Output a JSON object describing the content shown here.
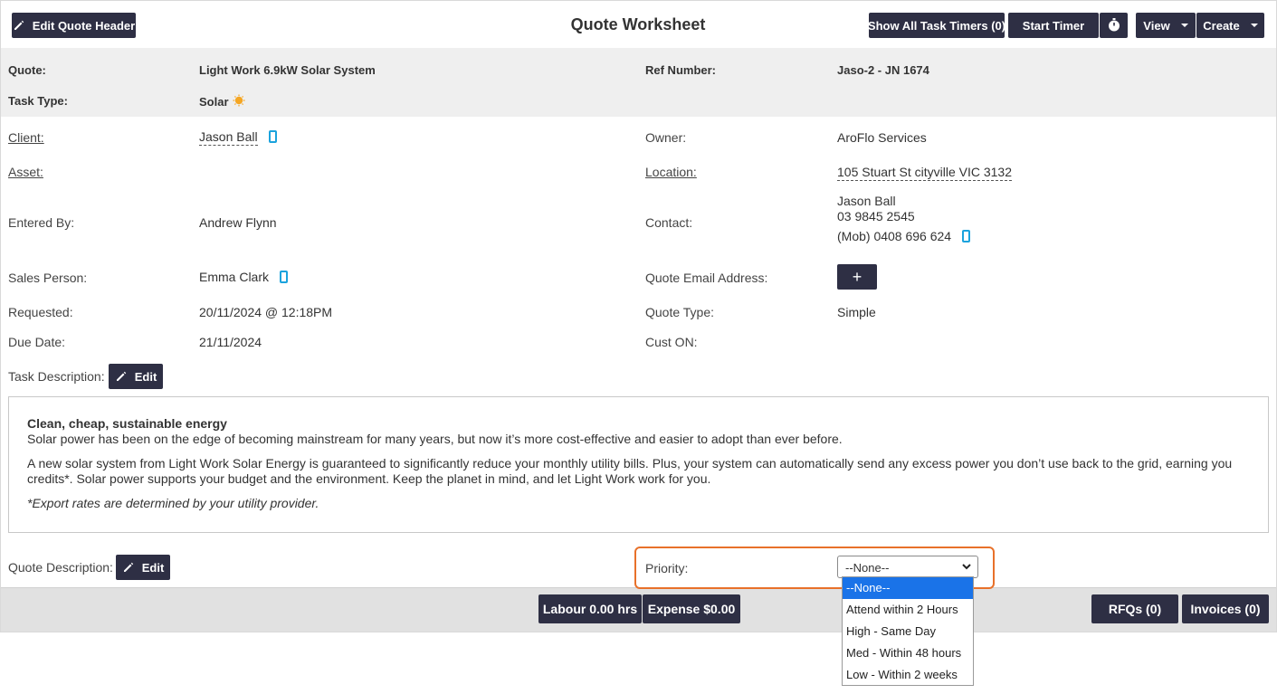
{
  "header": {
    "edit_quote_header": "Edit Quote Header",
    "title": "Quote Worksheet",
    "show_timers": "Show All Task Timers (0)",
    "start_timer": "Start Timer",
    "view": "View",
    "create": "Create"
  },
  "summary": {
    "quote_label": "Quote:",
    "quote_value": "Light Work 6.9kW Solar System",
    "ref_label": "Ref Number:",
    "ref_value": "Jaso-2 - JN 1674",
    "task_type_label": "Task Type:",
    "task_type_value": "Solar"
  },
  "details": {
    "client_label": "Client:",
    "client_value": "Jason Ball",
    "owner_label": "Owner:",
    "owner_value": "AroFlo Services",
    "asset_label": "Asset:",
    "location_label": "Location:",
    "location_value": "105 Stuart St cityville VIC 3132",
    "entered_by_label": "Entered By:",
    "entered_by_value": "Andrew Flynn",
    "contact_label": "Contact:",
    "contact_name": "Jason Ball",
    "contact_phone": "03 9845 2545",
    "contact_mobile": "(Mob) 0408 696 624",
    "sales_person_label": "Sales Person:",
    "sales_person_value": "Emma Clark",
    "quote_email_label": "Quote Email Address:",
    "add_email": "+",
    "requested_label": "Requested:",
    "requested_value": "20/11/2024 @ 12:18PM",
    "quote_type_label": "Quote Type:",
    "quote_type_value": "Simple",
    "due_date_label": "Due Date:",
    "due_date_value": "21/11/2024",
    "cust_on_label": "Cust ON:"
  },
  "task_description": {
    "label": "Task Description:",
    "edit": "Edit",
    "heading": "Clean, cheap, sustainable energy",
    "line1": "Solar power has been on the edge of becoming mainstream for many years, but now it’s more cost-effective and easier to adopt than ever before.",
    "para2": "A new solar system from Light Work Solar Energy is guaranteed to significantly reduce your monthly utility bills. Plus, your system can automatically send any excess power you don’t use back to the grid, earning you credits*. Solar power supports your budget and the environment. Keep the planet in mind, and let Light Work work for you.",
    "note": "*Export rates are determined by your utility provider."
  },
  "quote_description": {
    "label": "Quote Description:",
    "edit": "Edit"
  },
  "priority": {
    "label": "Priority:",
    "selected": "--None--",
    "options": [
      "--None--",
      "Attend within 2 Hours",
      "High - Same Day",
      "Med - Within 48 hours",
      "Low - Within 2 weeks"
    ]
  },
  "footer": {
    "labour": "Labour 0.00 hrs",
    "expense": "Expense $0.00",
    "rfqs": "RFQs (0)",
    "invoices": "Invoices (0)"
  },
  "colors": {
    "button_bg": "#2e2f44",
    "phone_icon": "#1ba3dd",
    "highlight": "#e8712a",
    "selected_option": "#1a73e8"
  }
}
